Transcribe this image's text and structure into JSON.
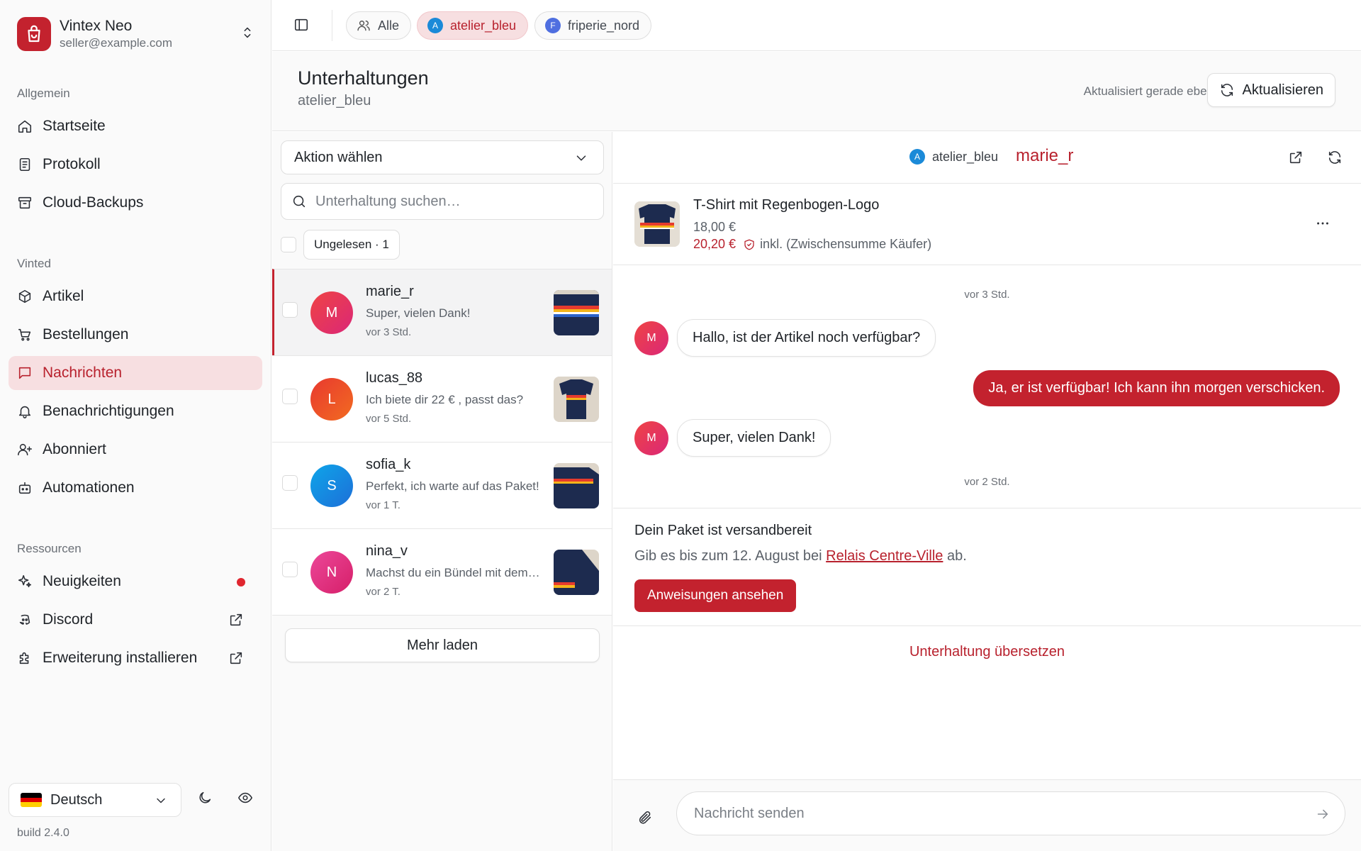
{
  "sidebar": {
    "brand": {
      "name": "Vintex Neo",
      "email": "seller@example.com"
    },
    "sections": {
      "general": "Allgemein",
      "vinted": "Vinted",
      "resources": "Ressourcen"
    },
    "items": [
      {
        "label": "Startseite",
        "icon": "home-icon"
      },
      {
        "label": "Protokoll",
        "icon": "log-icon"
      },
      {
        "label": "Cloud-Backups",
        "icon": "archive-icon"
      },
      {
        "label": "Artikel",
        "icon": "package-icon"
      },
      {
        "label": "Bestellungen",
        "icon": "cart-icon"
      },
      {
        "label": "Nachrichten",
        "icon": "message-icon"
      },
      {
        "label": "Benachrichtigungen",
        "icon": "bell-icon"
      },
      {
        "label": "Abonniert",
        "icon": "user-plus-icon"
      },
      {
        "label": "Automationen",
        "icon": "bot-icon"
      },
      {
        "label": "Neuigkeiten",
        "icon": "sparkles-icon"
      },
      {
        "label": "Discord",
        "icon": "discord-icon"
      },
      {
        "label": "Erweiterung installieren",
        "icon": "puzzle-icon"
      }
    ],
    "language": "Deutsch",
    "build": "build 2.4.0"
  },
  "topbar": {
    "chips": [
      {
        "label": "Alle"
      },
      {
        "label": "atelier_bleu",
        "avatar": "A"
      },
      {
        "label": "friperie_nord",
        "avatar": "F"
      }
    ]
  },
  "header": {
    "title": "Unterhaltungen",
    "subtitle": "atelier_bleu",
    "updated": "Aktualisiert gerade eben",
    "refresh": "Aktualisieren"
  },
  "list": {
    "action_select": "Aktion wählen",
    "search_placeholder": "Unterhaltung suchen…",
    "filter": "Ungelesen · 1",
    "conversations": [
      {
        "initial": "M",
        "name": "marie_r",
        "message": "Super, vielen Dank!",
        "time": "vor 3 Std."
      },
      {
        "initial": "L",
        "name": "lucas_88",
        "message": "Ich biete dir 22 € , passt das?",
        "time": "vor 5 Std."
      },
      {
        "initial": "S",
        "name": "sofia_k",
        "message": "Perfekt, ich warte auf das Paket!",
        "time": "vor 1 T."
      },
      {
        "initial": "N",
        "name": "nina_v",
        "message": "Machst du ein Bündel mit dem anderen?",
        "time": "vor 2 T."
      }
    ],
    "load_more": "Mehr laden"
  },
  "chat": {
    "account": "atelier_bleu",
    "account_avatar": "A",
    "user": "marie_r",
    "product": {
      "title": "T-Shirt mit Regenbogen-Logo",
      "price": "18,00 €",
      "total": "20,20 €",
      "total_note": "inkl. (Zwischensumme Käufer)"
    },
    "timestamps": [
      "vor 3 Std.",
      "vor 2 Std."
    ],
    "messages": [
      {
        "from": "buyer",
        "avatar": "M",
        "text": "Hallo, ist der Artikel noch verfügbar?"
      },
      {
        "from": "me",
        "text": "Ja, er ist verfügbar! Ich kann ihn morgen verschicken."
      },
      {
        "from": "buyer",
        "avatar": "M",
        "text": "Super, vielen Dank!"
      }
    ],
    "shipping": {
      "title": "Dein Paket ist versandbereit",
      "text_before": "Gib es bis zum 12. August bei ",
      "link": "Relais Centre-Ville",
      "text_after": " ab.",
      "button": "Anweisungen ansehen"
    },
    "translate": "Unterhaltung übersetzen",
    "composer_placeholder": "Nachricht senden"
  },
  "colors": {
    "accent": "#c3222e",
    "accent_soft": "#f7dfe1"
  }
}
